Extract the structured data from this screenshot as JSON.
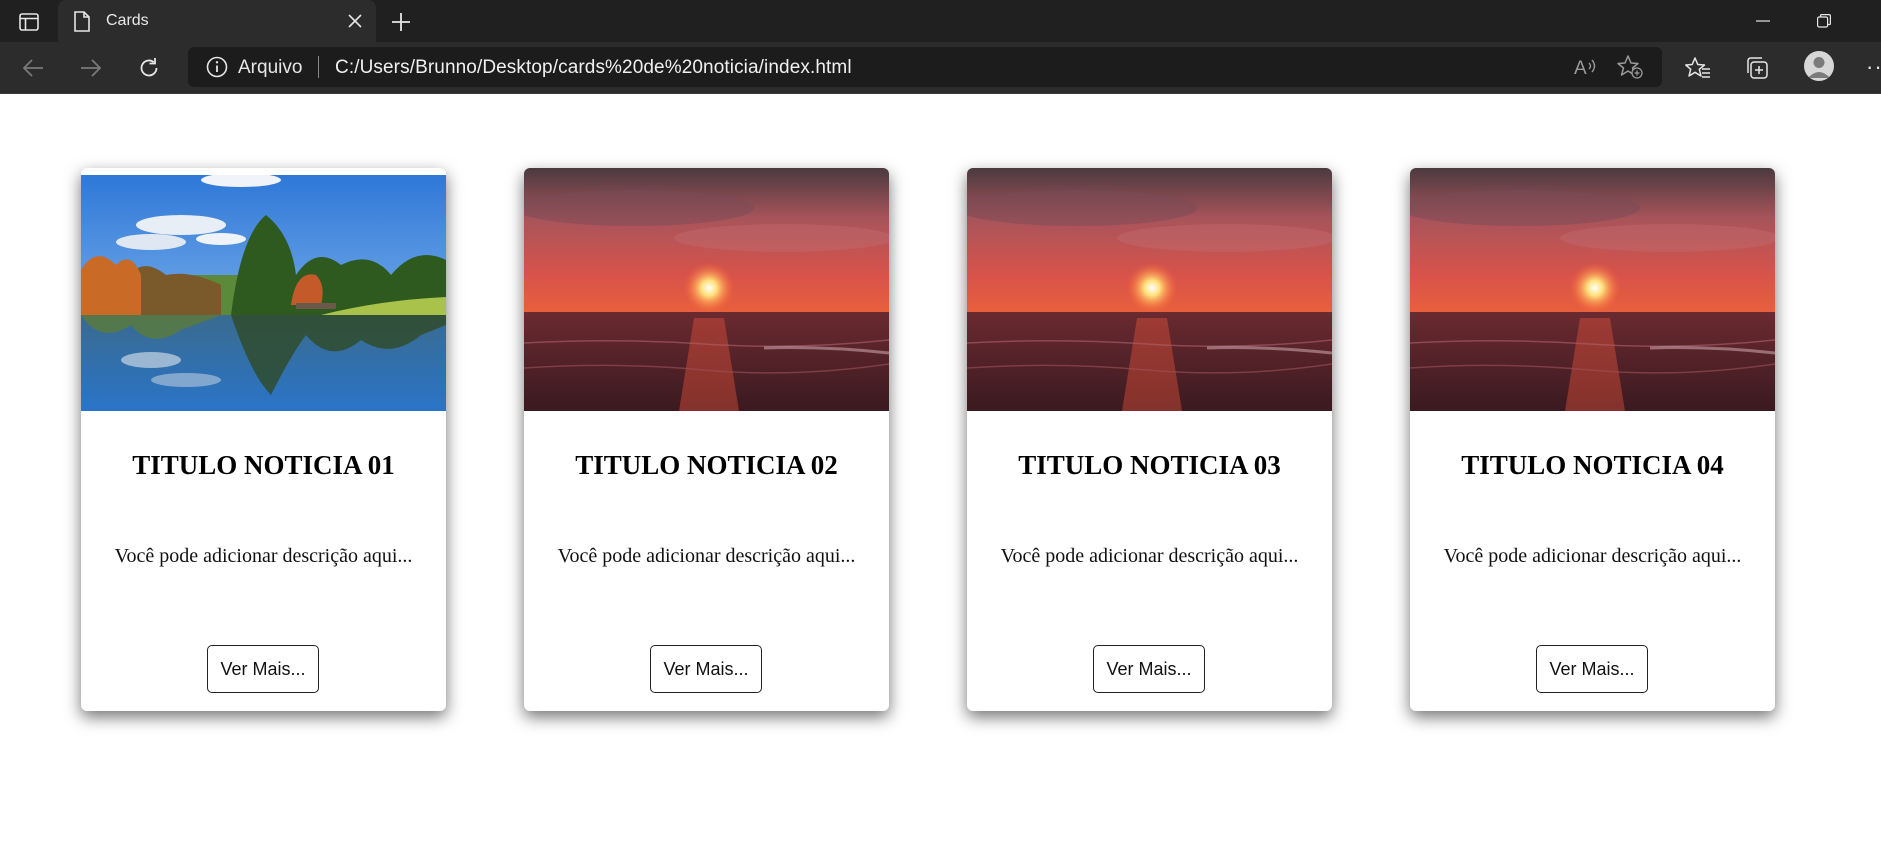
{
  "browser": {
    "tab_title": "Cards",
    "site_label": "Arquivo",
    "url": "C:/Users/Brunno/Desktop/cards%20de%20noticia/index.html",
    "readaloud_label": "A"
  },
  "cards": [
    {
      "title": "TITULO NOTICIA 01",
      "description": "Você pode adicionar descrição aqui...",
      "button": "Ver Mais...",
      "image": "lake-landscape"
    },
    {
      "title": "TITULO NOTICIA 02",
      "description": "Você pode adicionar descrição aqui...",
      "button": "Ver Mais...",
      "image": "sunset-sea"
    },
    {
      "title": "TITULO NOTICIA 03",
      "description": "Você pode adicionar descrição aqui...",
      "button": "Ver Mais...",
      "image": "sunset-sea"
    },
    {
      "title": "TITULO NOTICIA 04",
      "description": "Você pode adicionar descrição aqui...",
      "button": "Ver Mais...",
      "image": "sunset-sea"
    }
  ],
  "colors": {
    "chrome_bg": "#202020",
    "toolbar_bg": "#2c2c2c",
    "addressbar_bg": "#1c1c1c",
    "page_bg": "#ffffff"
  },
  "icons": [
    "sidebar-icon",
    "page-icon",
    "close-icon",
    "plus-icon",
    "minimize-icon",
    "restore-icon",
    "back-icon",
    "forward-icon",
    "refresh-icon",
    "info-icon",
    "read-aloud-icon",
    "add-favorite-icon",
    "favorites-icon",
    "collections-icon",
    "profile-icon",
    "more-icon"
  ]
}
